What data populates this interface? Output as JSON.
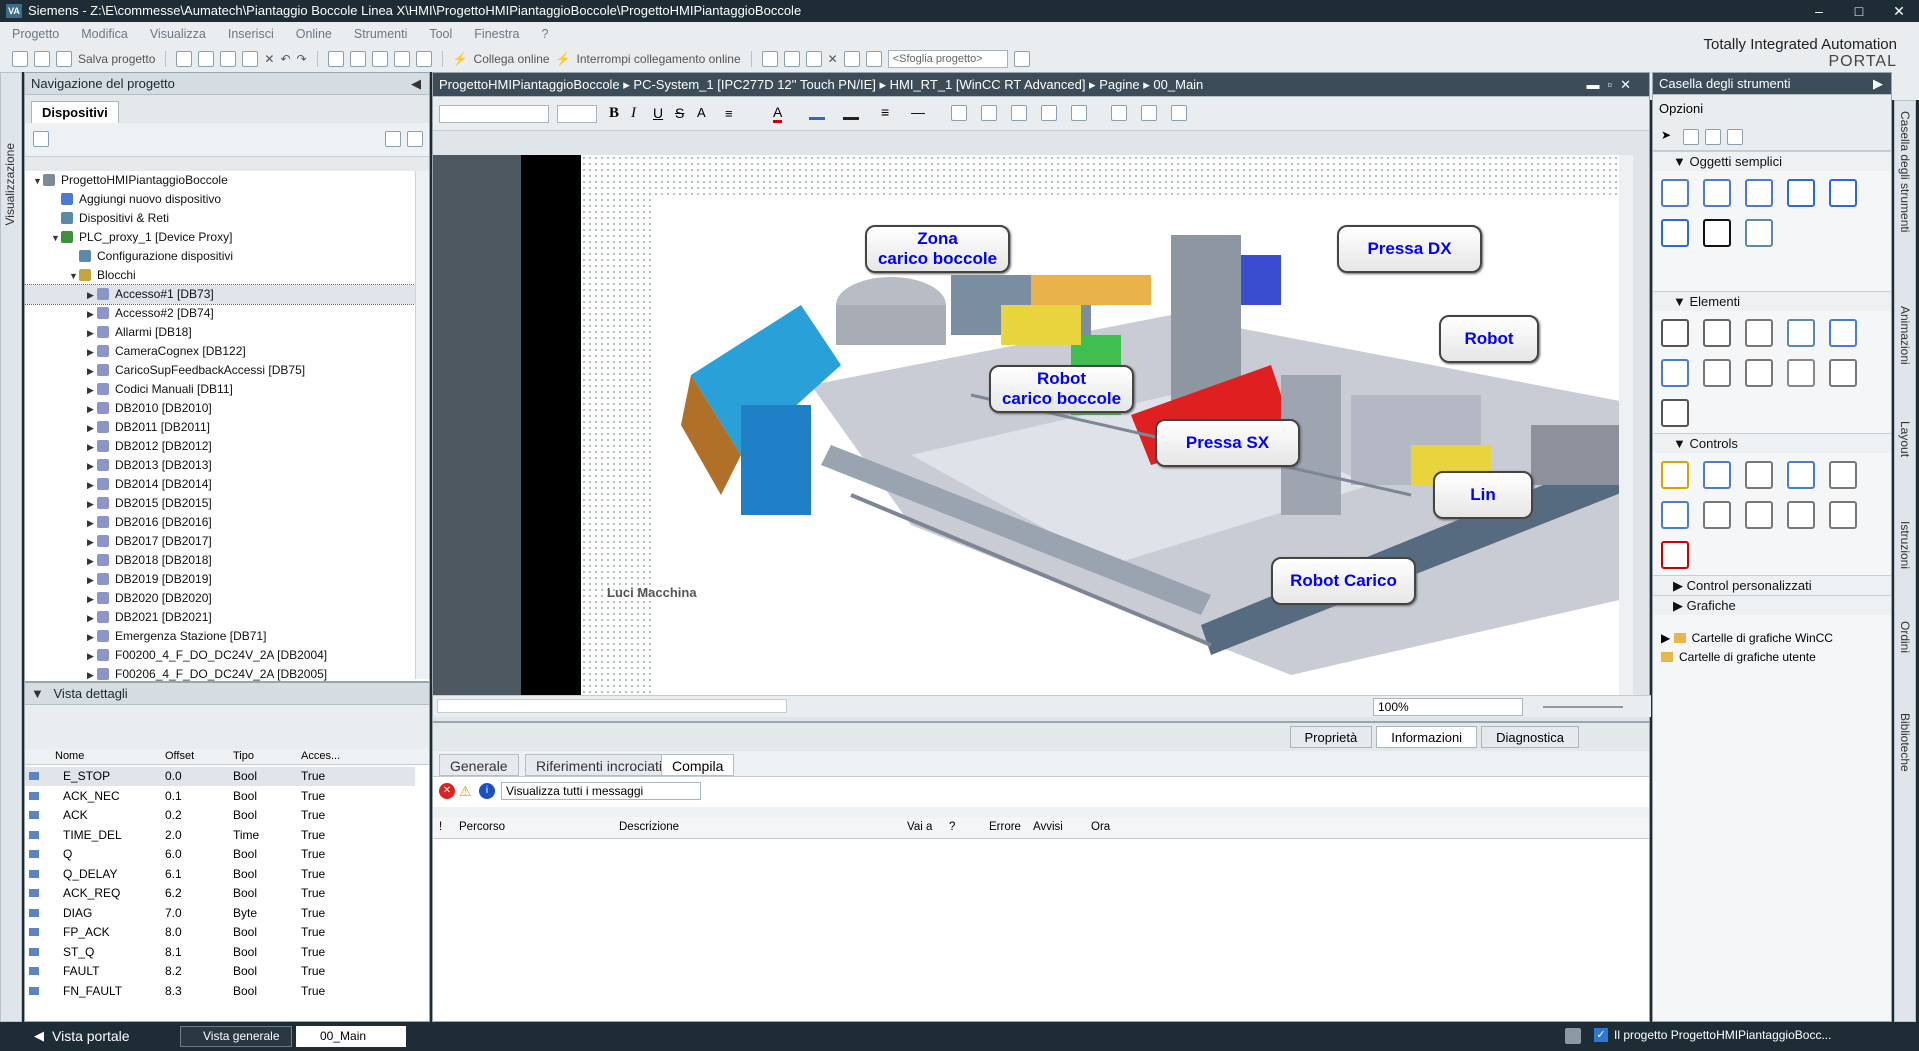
{
  "titlebar": {
    "text": "Siemens  -  Z:\\E\\commesse\\Aumatech\\Piantaggio Boccole Linea X\\HMI\\ProgettoHMIPiantaggioBoccole\\ProgettoHMIPiantaggioBoccole",
    "logo": "VA"
  },
  "menu": [
    "Progetto",
    "Modifica",
    "Visualizza",
    "Inserisci",
    "Online",
    "Strumenti",
    "Tool",
    "Finestra",
    "?"
  ],
  "toolbar": {
    "save": "Salva progetto",
    "connect": "Collega online",
    "disconnect": "Interrompi collegamento online",
    "search_placeholder": "<Sfoglia progetto>"
  },
  "brand": {
    "line1": "Totally Integrated Automation",
    "line2": "PORTAL"
  },
  "left_vtab": "Visualizzazione",
  "project_nav": {
    "title": "Navigazione del progetto",
    "tab": "Dispositivi",
    "tree": [
      {
        "label": "ProgettoHMIPiantaggioBoccole",
        "indent": 0,
        "arrow": "▼",
        "icon": "#7a8a96"
      },
      {
        "label": "Aggiungi nuovo dispositivo",
        "indent": 1,
        "arrow": "",
        "icon": "#4a7bd0"
      },
      {
        "label": "Dispositivi & Reti",
        "indent": 1,
        "arrow": "",
        "icon": "#5a8aa8"
      },
      {
        "label": "PLC_proxy_1 [Device Proxy]",
        "indent": 1,
        "arrow": "▼",
        "icon": "#3e8f3e"
      },
      {
        "label": "Configurazione dispositivi",
        "indent": 2,
        "arrow": "",
        "icon": "#5a8aa8"
      },
      {
        "label": "Blocchi",
        "indent": 2,
        "arrow": "▼",
        "icon": "#c8a43c"
      },
      {
        "label": "Accesso#1 [DB73]",
        "indent": 3,
        "arrow": "▶",
        "icon": "#8a96c8",
        "selected": true
      },
      {
        "label": "Accesso#2 [DB74]",
        "indent": 3,
        "arrow": "▶",
        "icon": "#8a96c8"
      },
      {
        "label": "Allarmi [DB18]",
        "indent": 3,
        "arrow": "▶",
        "icon": "#8a96c8"
      },
      {
        "label": "CameraCognex [DB122]",
        "indent": 3,
        "arrow": "▶",
        "icon": "#8a96c8"
      },
      {
        "label": "CaricoSupFeedbackAccessi [DB75]",
        "indent": 3,
        "arrow": "▶",
        "icon": "#8a96c8"
      },
      {
        "label": "Codici Manuali [DB11]",
        "indent": 3,
        "arrow": "▶",
        "icon": "#8a96c8"
      },
      {
        "label": "DB2010 [DB2010]",
        "indent": 3,
        "arrow": "▶",
        "icon": "#8a96c8"
      },
      {
        "label": "DB2011 [DB2011]",
        "indent": 3,
        "arrow": "▶",
        "icon": "#8a96c8"
      },
      {
        "label": "DB2012 [DB2012]",
        "indent": 3,
        "arrow": "▶",
        "icon": "#8a96c8"
      },
      {
        "label": "DB2013 [DB2013]",
        "indent": 3,
        "arrow": "▶",
        "icon": "#8a96c8"
      },
      {
        "label": "DB2014 [DB2014]",
        "indent": 3,
        "arrow": "▶",
        "icon": "#8a96c8"
      },
      {
        "label": "DB2015 [DB2015]",
        "indent": 3,
        "arrow": "▶",
        "icon": "#8a96c8"
      },
      {
        "label": "DB2016 [DB2016]",
        "indent": 3,
        "arrow": "▶",
        "icon": "#8a96c8"
      },
      {
        "label": "DB2017 [DB2017]",
        "indent": 3,
        "arrow": "▶",
        "icon": "#8a96c8"
      },
      {
        "label": "DB2018 [DB2018]",
        "indent": 3,
        "arrow": "▶",
        "icon": "#8a96c8"
      },
      {
        "label": "DB2019 [DB2019]",
        "indent": 3,
        "arrow": "▶",
        "icon": "#8a96c8"
      },
      {
        "label": "DB2020 [DB2020]",
        "indent": 3,
        "arrow": "▶",
        "icon": "#8a96c8"
      },
      {
        "label": "DB2021 [DB2021]",
        "indent": 3,
        "arrow": "▶",
        "icon": "#8a96c8"
      },
      {
        "label": "Emergenza Stazione [DB71]",
        "indent": 3,
        "arrow": "▶",
        "icon": "#8a96c8"
      },
      {
        "label": "F00200_4_F_DO_DC24V_2A [DB2004]",
        "indent": 3,
        "arrow": "▶",
        "icon": "#8a96c8"
      },
      {
        "label": "F00206_4_F_DO_DC24V_2A [DB2005]",
        "indent": 3,
        "arrow": "▶",
        "icon": "#8a96c8"
      }
    ]
  },
  "details": {
    "title": "Vista dettagli",
    "columns": [
      "Nome",
      "Offset",
      "Tipo",
      "Acces..."
    ],
    "rows": [
      [
        "E_STOP",
        "0.0",
        "Bool",
        "True"
      ],
      [
        "ACK_NEC",
        "0.1",
        "Bool",
        "True"
      ],
      [
        "ACK",
        "0.2",
        "Bool",
        "True"
      ],
      [
        "TIME_DEL",
        "2.0",
        "Time",
        "True"
      ],
      [
        "Q",
        "6.0",
        "Bool",
        "True"
      ],
      [
        "Q_DELAY",
        "6.1",
        "Bool",
        "True"
      ],
      [
        "ACK_REQ",
        "6.2",
        "Bool",
        "True"
      ],
      [
        "DIAG",
        "7.0",
        "Byte",
        "True"
      ],
      [
        "FP_ACK",
        "8.0",
        "Bool",
        "True"
      ],
      [
        "ST_Q",
        "8.1",
        "Bool",
        "True"
      ],
      [
        "FAULT",
        "8.2",
        "Bool",
        "True"
      ],
      [
        "FN_FAULT",
        "8.3",
        "Bool",
        "True"
      ]
    ]
  },
  "editor": {
    "breadcrumb": [
      "ProgettoHMIPiantaggioBoccole",
      "PC-System_1 [IPC277D 12'' Touch PN/IE]",
      "HMI_RT_1 [WinCC RT Advanced]",
      "Pagine",
      "00_Main"
    ],
    "labels": [
      {
        "text": "Zona\ncarico boccole",
        "id": "zona"
      },
      {
        "text": "Pressa DX",
        "id": "pressadx"
      },
      {
        "text": "Robot",
        "id": "robot"
      },
      {
        "text": "Robot\ncarico boccole",
        "id": "robotcarico"
      },
      {
        "text": "Pressa SX",
        "id": "pressasx"
      },
      {
        "text": "Lin",
        "id": "lin"
      },
      {
        "text": "Robot Carico",
        "id": "robotcaricob"
      }
    ],
    "cut_text": "Luci Macchina",
    "zoom": "100%"
  },
  "inspector": {
    "tabs": [
      "Proprietà",
      "Informazioni",
      "Diagnostica"
    ],
    "subtabs": [
      "Generale",
      "Riferimenti incrociati",
      "Compila"
    ],
    "filter": "Visualizza tutti i messaggi",
    "columns": [
      "!",
      "Percorso",
      "Descrizione",
      "Vai a",
      "?",
      "Errore",
      "Avvisi",
      "Ora"
    ]
  },
  "toolbox": {
    "title": "Casella degli strumenti",
    "options": "Opzioni",
    "sections": [
      "Oggetti semplici",
      "Elementi",
      "Controls",
      "Control personalizzati",
      "Grafiche"
    ],
    "graphics": [
      "Cartelle di grafiche WinCC",
      "Cartelle di grafiche utente"
    ]
  },
  "right_vtabs": [
    "Casella degli strumenti",
    "Animazioni",
    "Layout",
    "Istruzioni",
    "Ordini",
    "Biblioteche"
  ],
  "statusbar": {
    "portal": "Vista portale",
    "overview": "Vista generale",
    "current": "00_Main",
    "message": "Il progetto ProgettoHMIPiantaggioBocc..."
  }
}
